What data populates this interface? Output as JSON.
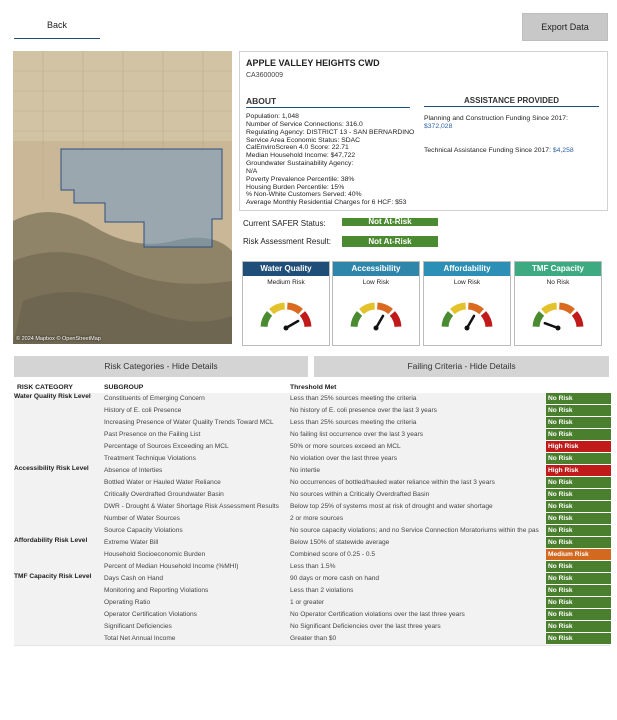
{
  "nav": {
    "back_label": "Back",
    "export_label": "Export Data"
  },
  "map": {
    "credit": "© 2024 Mapbox © OpenStreetMap"
  },
  "system": {
    "name": "APPLE VALLEY HEIGHTS CWD",
    "code": "CA3600009",
    "about_heading": "ABOUT",
    "about_lines": [
      "Population: 1,048",
      "Number of Service Connections: 316.0",
      "Regulating Agency: DISTRICT 13 - SAN BERNARDINO",
      "Service Area Economic Status: SDAC",
      "CalEnviroScreen 4.0 Score: 22.71",
      "Median Household Income: $47,722",
      "Groundwater Sustainability Agency:",
      "N/A",
      "Poverty Prevalence Percentile: 38%",
      "Housing Burden Percentile: 15%",
      "% Non-White Customers Served: 40%",
      "Average Monthly Residential Charges for 6 HCF: $53"
    ],
    "assistance_heading": "ASSISTANCE PROVIDED",
    "planning_label": "Planning and Construction Funding Since 2017:",
    "planning_value": "$372,028",
    "technical_label": "Technical Assistance Funding Since 2017:",
    "technical_value": "$4,258"
  },
  "status": {
    "safer_label": "Current SAFER Status:",
    "safer_value": "Not At-Risk",
    "risk_label": "Risk Assessment Result:",
    "risk_value": "Not At-Risk"
  },
  "cards": [
    {
      "title": "Water Quality",
      "level": "Medium Risk",
      "color": "#1f4e79"
    },
    {
      "title": "Accessibility",
      "level": "Low Risk",
      "color": "#2e86ab"
    },
    {
      "title": "Affordability",
      "level": "Low Risk",
      "color": "#2c8fb5"
    },
    {
      "title": "TMF Capacity",
      "level": "No Risk",
      "color": "#3daa82"
    }
  ],
  "toggles": {
    "categories_label": "Risk Categories - Hide Details",
    "failing_label": "Failing Criteria - Hide Details"
  },
  "table": {
    "headers": {
      "category": "RISK CATEGORY",
      "subgroup": "SUBGROUP",
      "threshold": "Threshold Met"
    },
    "risk_colors": {
      "No Risk": "#4a7f2e",
      "High Risk": "#c01a1a",
      "Medium Risk": "#d2691e"
    },
    "rows": [
      {
        "cat": "Water Quality Risk Level",
        "sub": "Constituents of Emerging Concern",
        "thr": "Less than 25% sources meeting the criteria",
        "risk": "No Risk"
      },
      {
        "cat": "",
        "sub": "History of E. coli Presence",
        "thr": "No history of E. coli presence over the last 3 years",
        "risk": "No Risk"
      },
      {
        "cat": "",
        "sub": "Increasing Presence of Water Quality Trends Toward MCL",
        "thr": "Less than 25% sources meeting the criteria",
        "risk": "No Risk"
      },
      {
        "cat": "",
        "sub": "Past Presence on the Failing List",
        "thr": "No failing list occurrence over the last 3 years",
        "risk": "No Risk"
      },
      {
        "cat": "",
        "sub": "Percentage of Sources Exceeding an MCL",
        "thr": "50% or more sources exceed an MCL",
        "risk": "High Risk"
      },
      {
        "cat": "",
        "sub": "Treatment Technique Violations",
        "thr": "No violation over the last three years",
        "risk": "No Risk"
      },
      {
        "cat": "Accessibility Risk Level",
        "sub": "Absence of Interties",
        "thr": "No intertie",
        "risk": "High Risk"
      },
      {
        "cat": "",
        "sub": "Bottled Water or Hauled Water Reliance",
        "thr": "No occurrences of bottled/hauled water reliance within the last 3 years",
        "risk": "No Risk"
      },
      {
        "cat": "",
        "sub": "Critically Overdrafted Groundwater Basin",
        "thr": "No sources within a Critically Overdrafted Basin",
        "risk": "No Risk"
      },
      {
        "cat": "",
        "sub": "DWR - Drought & Water Shortage Risk Assessment Results",
        "thr": "Below top 25% of systems most at risk of drought and water shortage",
        "risk": "No Risk"
      },
      {
        "cat": "",
        "sub": "Number of Water Sources",
        "thr": "2 or more sources",
        "risk": "No Risk"
      },
      {
        "cat": "",
        "sub": "Source Capacity Violations",
        "thr": "No source capacity violations; and no Service Connection Moratoriums within the pas",
        "risk": "No Risk"
      },
      {
        "cat": "Affordability Risk Level",
        "sub": "Extreme Water Bill",
        "thr": "Below 150% of statewide average",
        "risk": "No Risk"
      },
      {
        "cat": "",
        "sub": "Household Socioeconomic Burden",
        "thr": "Combined score of 0.25 - 0.5",
        "risk": "Medium Risk"
      },
      {
        "cat": "",
        "sub": "Percent of Median Household Income (%MHI)",
        "thr": "Less than 1.5%",
        "risk": "No Risk"
      },
      {
        "cat": "TMF Capacity Risk Level",
        "sub": "Days Cash on Hand",
        "thr": "90 days or more cash on hand",
        "risk": "No Risk"
      },
      {
        "cat": "",
        "sub": "Monitoring and Reporting Violations",
        "thr": "Less than 2 violations",
        "risk": "No Risk"
      },
      {
        "cat": "",
        "sub": "Operating Ratio",
        "thr": "1 or greater",
        "risk": "No Risk"
      },
      {
        "cat": "",
        "sub": "Operator Certification Violations",
        "thr": "No Operator Certification violations over the last three years",
        "risk": "No Risk"
      },
      {
        "cat": "",
        "sub": "Significant Deficiencies",
        "thr": "No Significant Deficiencies over the last three years",
        "risk": "No Risk"
      },
      {
        "cat": "",
        "sub": "Total Net Annual Income",
        "thr": "Greater than $0",
        "risk": "No Risk"
      }
    ]
  }
}
